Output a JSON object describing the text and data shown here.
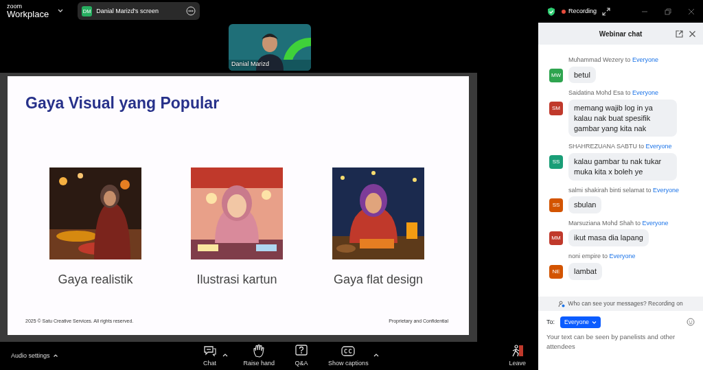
{
  "app": {
    "logo_top": "zoom",
    "logo_bottom": "Workplace"
  },
  "share_pill": {
    "initials": "DM",
    "label": "Danial Marizd's screen"
  },
  "recording": {
    "label": "Recording"
  },
  "video_tile": {
    "name": "Danial Marizd",
    "kind": "picture"
  },
  "slide": {
    "title": "Gaya Visual yang Popular",
    "items": [
      {
        "caption": "Gaya realistik",
        "kind": "picture"
      },
      {
        "caption": "Ilustrasi kartun",
        "kind": "picture"
      },
      {
        "caption": "Gaya flat design",
        "kind": "picture"
      }
    ],
    "footer_left": "2025 © Satu Creative Services. All rights reserved.",
    "footer_right": "Proprietary and Confidential"
  },
  "chat": {
    "title": "Webinar chat",
    "messages": [
      {
        "sender": "Muhammad Wezery",
        "to_word": "to",
        "recipient": "Everyone",
        "initials": "MW",
        "color": "#2ea44f",
        "text": "betul"
      },
      {
        "sender": "Saidatina Mohd Esa",
        "to_word": "to",
        "recipient": "Everyone",
        "initials": "SM",
        "color": "#c0392b",
        "text": "memang wajib log in ya kalau nak buat spesifik gambar yang kita nak"
      },
      {
        "sender": "SHAHREZUANA SABTU",
        "to_word": "to",
        "recipient": "Everyone",
        "initials": "SS",
        "color": "#1a9e77",
        "text": "kalau gambar tu nak tukar muka kita x boleh ye"
      },
      {
        "sender": "salmi shakirah binti selamat",
        "to_word": "to",
        "recipient": "Everyone",
        "initials": "SS",
        "color": "#d35400",
        "text": "sbulan"
      },
      {
        "sender": "Marsuziana Mohd Shah",
        "to_word": "to",
        "recipient": "Everyone",
        "initials": "MM",
        "color": "#c0392b",
        "text": "ikut masa dia lapang"
      },
      {
        "sender": "noni empire",
        "to_word": "to",
        "recipient": "Everyone",
        "initials": "NE",
        "color": "#d35400",
        "text": "lambat"
      }
    ],
    "notice": "Who can see your messages? Recording on",
    "to_label": "To:",
    "to_button": "Everyone",
    "input": {
      "placeholder": "Your text can be seen by panelists and other attendees"
    }
  },
  "toolbar": {
    "audio_settings": "Audio settings",
    "buttons": [
      {
        "kind": "chat",
        "label": "Chat",
        "caret": true
      },
      {
        "kind": "hand",
        "label": "Raise hand",
        "caret": false
      },
      {
        "kind": "qa",
        "label": "Q&A",
        "caret": false
      },
      {
        "kind": "cc",
        "label": "Show captions",
        "caret": true
      }
    ],
    "leave": "Leave"
  }
}
